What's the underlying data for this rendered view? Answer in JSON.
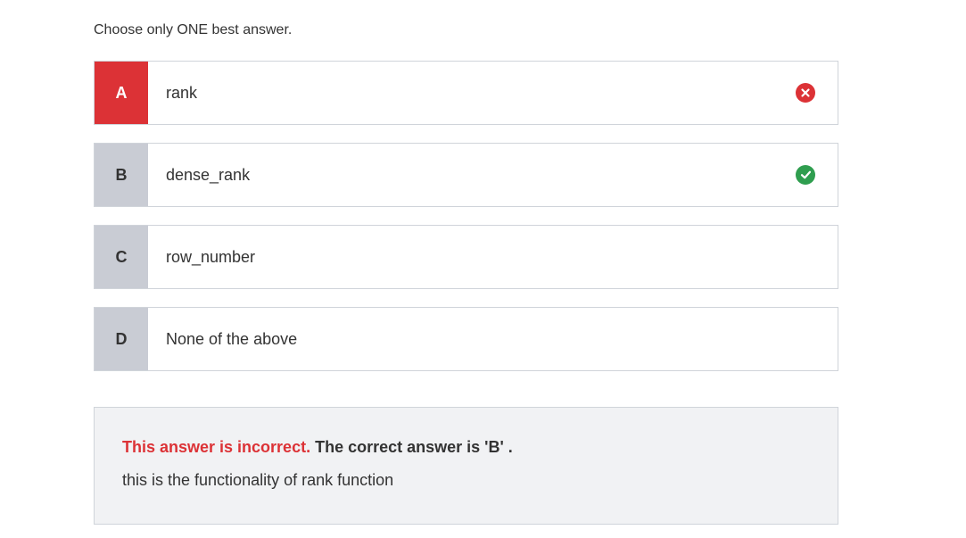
{
  "instruction": "Choose only ONE best answer.",
  "options": [
    {
      "letter": "A",
      "text": "rank",
      "status": "wrong",
      "status_icon": "x-circle-icon"
    },
    {
      "letter": "B",
      "text": "dense_rank",
      "status": "correct",
      "status_icon": "check-circle-icon"
    },
    {
      "letter": "C",
      "text": "row_number",
      "status": "none"
    },
    {
      "letter": "D",
      "text": "None of the above",
      "status": "none"
    }
  ],
  "feedback": {
    "incorrect_label": "This answer is incorrect.",
    "correct_answer_text": "The correct answer is 'B' .",
    "explanation": "this is the functionality of rank function"
  },
  "colors": {
    "wrong": "#dc3236",
    "correct": "#2f9e4f",
    "letter_bg": "#c9ccd4",
    "feedback_bg": "#f1f2f4"
  }
}
